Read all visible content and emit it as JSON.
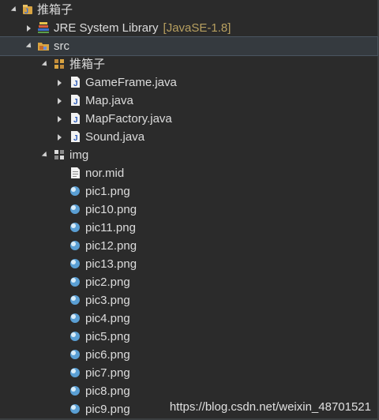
{
  "tree": {
    "project": {
      "label": "推箱子"
    },
    "jre": {
      "label": "JRE System Library",
      "decoration": "[JavaSE-1.8]"
    },
    "src": {
      "label": "src"
    },
    "package": {
      "label": "推箱子"
    },
    "java_files": [
      {
        "label": "GameFrame.java"
      },
      {
        "label": "Map.java"
      },
      {
        "label": "MapFactory.java"
      },
      {
        "label": "Sound.java"
      }
    ],
    "img_package": {
      "label": "img"
    },
    "img_files": [
      {
        "label": "nor.mid"
      },
      {
        "label": "pic1.png"
      },
      {
        "label": "pic10.png"
      },
      {
        "label": "pic11.png"
      },
      {
        "label": "pic12.png"
      },
      {
        "label": "pic13.png"
      },
      {
        "label": "pic2.png"
      },
      {
        "label": "pic3.png"
      },
      {
        "label": "pic4.png"
      },
      {
        "label": "pic5.png"
      },
      {
        "label": "pic6.png"
      },
      {
        "label": "pic7.png"
      },
      {
        "label": "pic8.png"
      },
      {
        "label": "pic9.png"
      }
    ]
  },
  "watermark": "https://blog.csdn.net/weixin_48701521",
  "colors": {
    "background": "#2b2b2b",
    "text": "#dcdcdc",
    "decoration": "#b8a060",
    "selection": "#353a3f"
  }
}
